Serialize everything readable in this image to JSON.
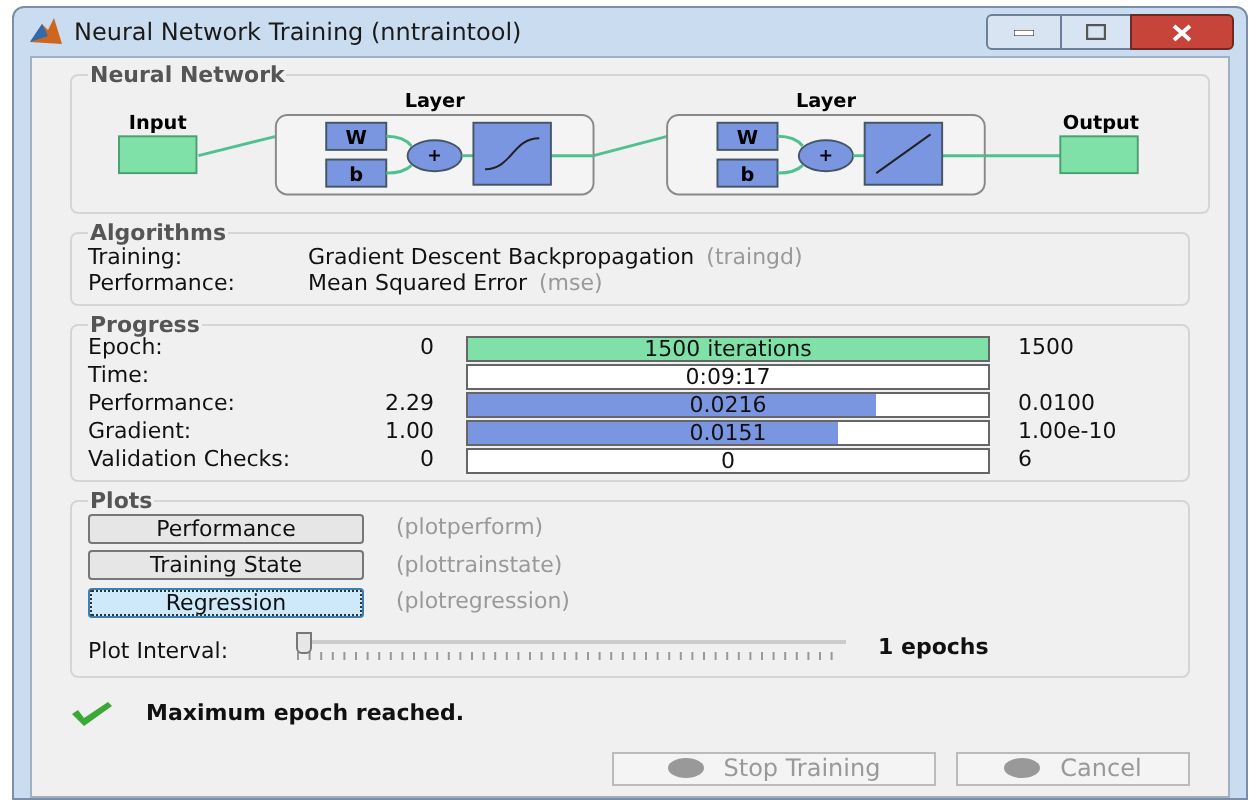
{
  "window": {
    "title": "Neural Network Training (nntraintool)"
  },
  "network": {
    "title": "Neural Network",
    "input_label": "Input",
    "output_label": "Output",
    "layers": [
      {
        "title": "Layer",
        "weight": "W",
        "bias": "b",
        "sum": "+",
        "kind": "sigmoid"
      },
      {
        "title": "Layer",
        "weight": "W",
        "bias": "b",
        "sum": "+",
        "kind": "linear"
      }
    ]
  },
  "algorithms": {
    "title": "Algorithms",
    "rows": [
      {
        "label": "Training:",
        "value": "Gradient Descent Backpropagation",
        "code": "(traingd)"
      },
      {
        "label": "Performance:",
        "value": "Mean Squared Error",
        "code": "(mse)"
      }
    ]
  },
  "progress": {
    "title": "Progress",
    "rows": [
      {
        "label": "Epoch:",
        "start": "0",
        "reading": "1500 iterations",
        "level": 1,
        "color": "#7fe0a8",
        "end": "1500"
      },
      {
        "label": "Time:",
        "reading": "0:09:17",
        "level": 0
      },
      {
        "label": "Performance:",
        "start": "2.29",
        "reading": "0.0216",
        "level": 0.785,
        "color": "#7b96e0",
        "end": "0.0100"
      },
      {
        "label": "Gradient:",
        "start": "1.00",
        "reading": "0.0151",
        "level": 0.71,
        "color": "#7b96e0",
        "end": "1.00e-10"
      },
      {
        "label": "Validation Checks:",
        "start": "0",
        "reading": "0",
        "level": 0,
        "end": "6"
      }
    ]
  },
  "plots": {
    "title": "Plots",
    "buttons": [
      {
        "label": "Performance",
        "function": "(plotperform)",
        "selected": false
      },
      {
        "label": "Training State",
        "function": "(plottrainstate)",
        "selected": false
      },
      {
        "label": "Regression",
        "function": "(plotregression)",
        "selected": true
      }
    ],
    "interval": {
      "label": "Plot Interval:",
      "level": 0,
      "reading": "1 epochs"
    }
  },
  "status": {
    "message": "Maximum epoch reached."
  },
  "buttons": [
    {
      "label": "Stop Training",
      "disabled": true
    },
    {
      "label": "Cancel",
      "disabled": true
    }
  ]
}
